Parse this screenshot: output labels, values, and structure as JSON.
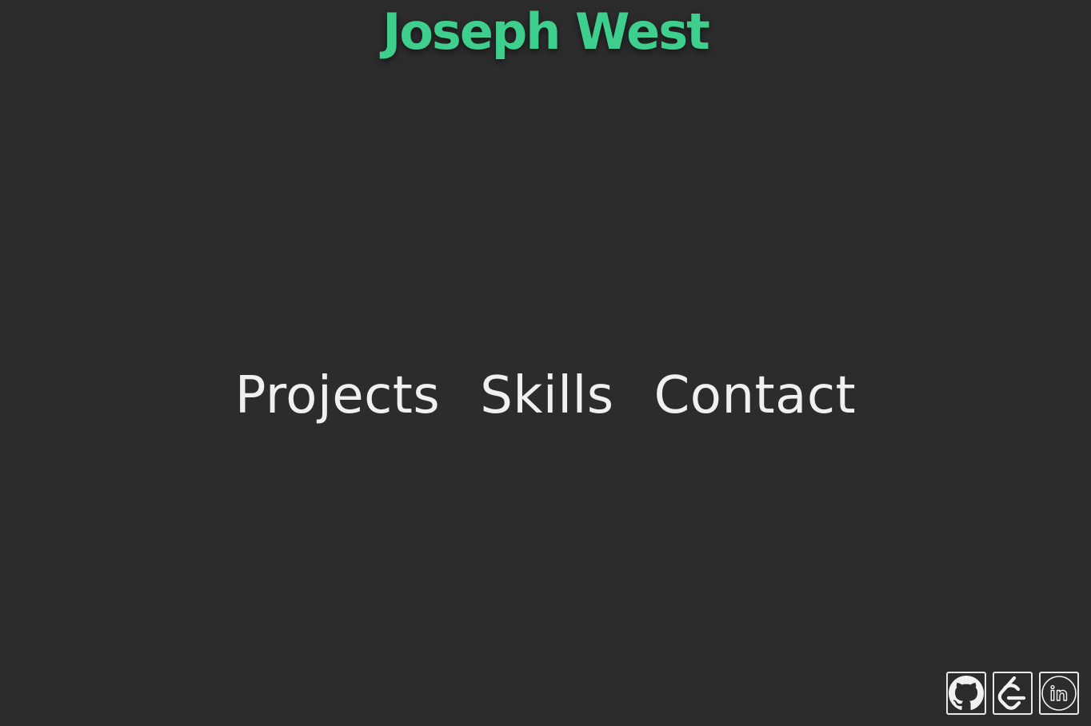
{
  "header": {
    "title": "Joseph West"
  },
  "nav": {
    "items": [
      {
        "label": "Projects"
      },
      {
        "label": "Skills"
      },
      {
        "label": "Contact"
      }
    ]
  },
  "social": {
    "items": [
      {
        "icon": "github-icon",
        "tooltip": ""
      },
      {
        "icon": "leetcode-icon",
        "tooltip": ""
      },
      {
        "icon": "linkedin-icon",
        "tooltip": ""
      }
    ]
  },
  "colors": {
    "background": "#2c2c2c",
    "title": "#3ecf8e",
    "nav_text": "#f0f0f0",
    "icon_border": "#e8e8e8"
  }
}
